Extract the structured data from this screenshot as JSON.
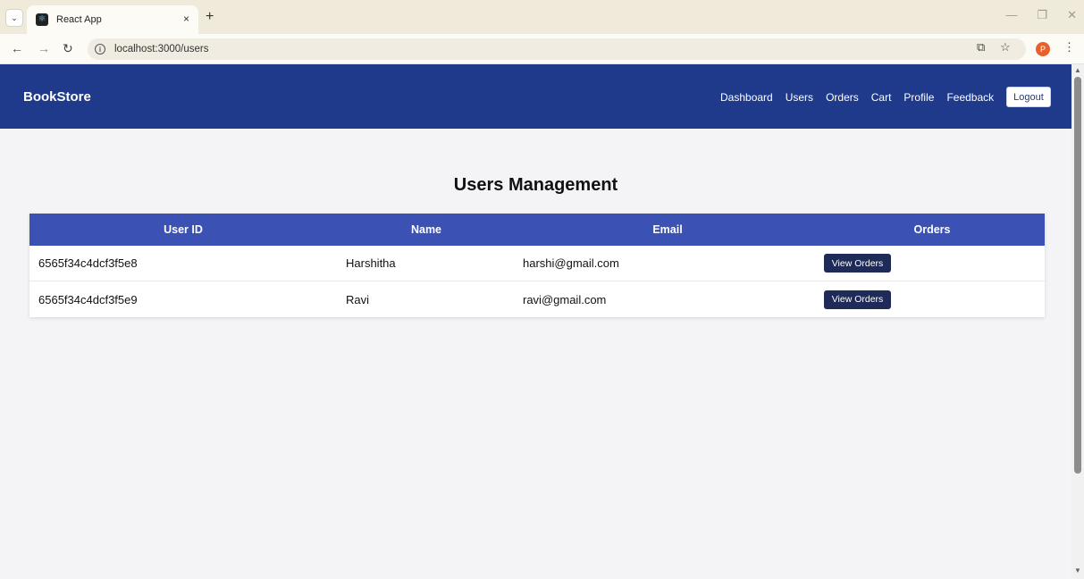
{
  "browser": {
    "tab_title": "React App",
    "tab_close": "×",
    "new_tab": "+",
    "url": "localhost:3000/users",
    "profile_initial": "P"
  },
  "navbar": {
    "brand": "BookStore",
    "links": [
      "Dashboard",
      "Users",
      "Orders",
      "Cart",
      "Profile",
      "Feedback"
    ],
    "logout": "Logout",
    "color": "#1f3a8a"
  },
  "page": {
    "title": "Users Management"
  },
  "table": {
    "headers": [
      "User ID",
      "Name",
      "Email",
      "Orders"
    ],
    "rows": [
      {
        "id": "6565f34c4dcf3f5e8",
        "name": "Harshitha",
        "email": "harshi@gmail.com",
        "action": "View Orders"
      },
      {
        "id": "6565f34c4dcf3f5e9",
        "name": "Ravi",
        "email": "ravi@gmail.com",
        "action": "View Orders"
      }
    ],
    "header_color": "#3b51b4",
    "button_color": "#1e2a57"
  }
}
